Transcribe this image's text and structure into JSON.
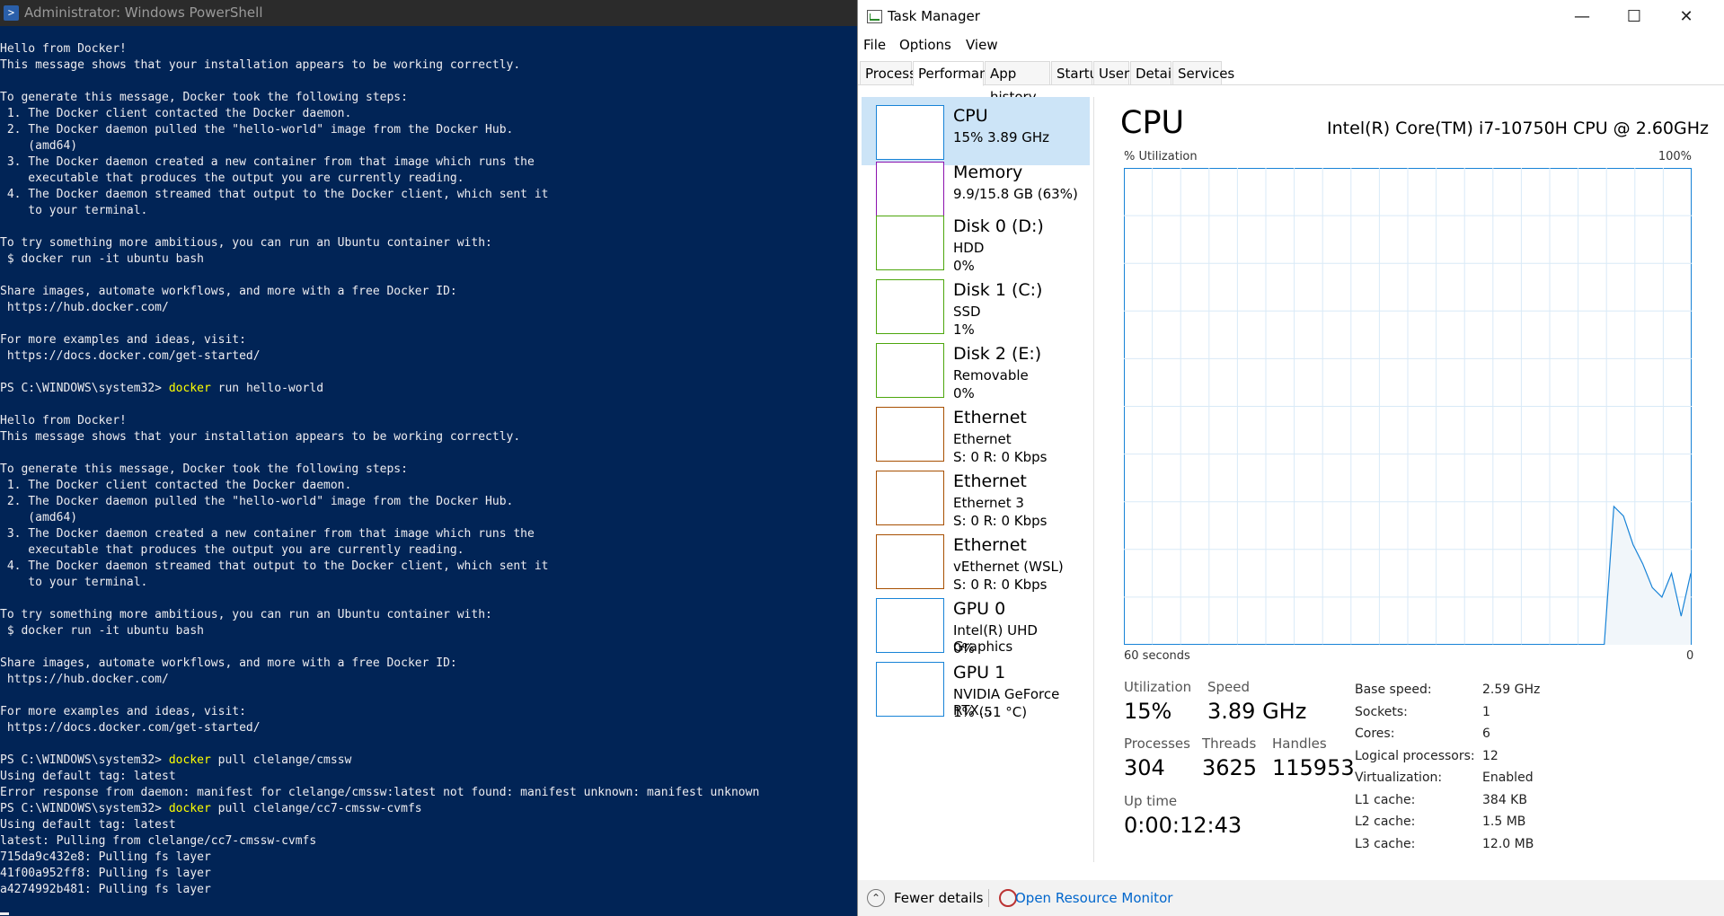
{
  "powershell": {
    "title": "Administrator: Windows PowerShell",
    "console": [
      {
        "text": "Hello from Docker!"
      },
      {
        "text": "This message shows that your installation appears to be working correctly."
      },
      {
        "text": ""
      },
      {
        "text": "To generate this message, Docker took the following steps:"
      },
      {
        "text": " 1. The Docker client contacted the Docker daemon."
      },
      {
        "text": " 2. The Docker daemon pulled the \"hello-world\" image from the Docker Hub."
      },
      {
        "text": "    (amd64)"
      },
      {
        "text": " 3. The Docker daemon created a new container from that image which runs the"
      },
      {
        "text": "    executable that produces the output you are currently reading."
      },
      {
        "text": " 4. The Docker daemon streamed that output to the Docker client, which sent it"
      },
      {
        "text": "    to your terminal."
      },
      {
        "text": ""
      },
      {
        "text": "To try something more ambitious, you can run an Ubuntu container with:"
      },
      {
        "text": " $ docker run -it ubuntu bash"
      },
      {
        "text": ""
      },
      {
        "text": "Share images, automate workflows, and more with a free Docker ID:"
      },
      {
        "text": " https://hub.docker.com/"
      },
      {
        "text": ""
      },
      {
        "text": "For more examples and ideas, visit:"
      },
      {
        "text": " https://docs.docker.com/get-started/"
      },
      {
        "text": ""
      },
      {
        "prompt": "PS C:\\WINDOWS\\system32> ",
        "cmd": "docker",
        "args": " run hello-world"
      },
      {
        "text": ""
      },
      {
        "text": "Hello from Docker!"
      },
      {
        "text": "This message shows that your installation appears to be working correctly."
      },
      {
        "text": ""
      },
      {
        "text": "To generate this message, Docker took the following steps:"
      },
      {
        "text": " 1. The Docker client contacted the Docker daemon."
      },
      {
        "text": " 2. The Docker daemon pulled the \"hello-world\" image from the Docker Hub."
      },
      {
        "text": "    (amd64)"
      },
      {
        "text": " 3. The Docker daemon created a new container from that image which runs the"
      },
      {
        "text": "    executable that produces the output you are currently reading."
      },
      {
        "text": " 4. The Docker daemon streamed that output to the Docker client, which sent it"
      },
      {
        "text": "    to your terminal."
      },
      {
        "text": ""
      },
      {
        "text": "To try something more ambitious, you can run an Ubuntu container with:"
      },
      {
        "text": " $ docker run -it ubuntu bash"
      },
      {
        "text": ""
      },
      {
        "text": "Share images, automate workflows, and more with a free Docker ID:"
      },
      {
        "text": " https://hub.docker.com/"
      },
      {
        "text": ""
      },
      {
        "text": "For more examples and ideas, visit:"
      },
      {
        "text": " https://docs.docker.com/get-started/"
      },
      {
        "text": ""
      },
      {
        "prompt": "PS C:\\WINDOWS\\system32> ",
        "cmd": "docker",
        "args": " pull clelange/cmssw"
      },
      {
        "text": "Using default tag: latest"
      },
      {
        "text": "Error response from daemon: manifest for clelange/cmssw:latest not found: manifest unknown: manifest unknown"
      },
      {
        "prompt": "PS C:\\WINDOWS\\system32> ",
        "cmd": "docker",
        "args": " pull clelange/cc7-cmssw-cvmfs"
      },
      {
        "text": "Using default tag: latest"
      },
      {
        "text": "latest: Pulling from clelange/cc7-cmssw-cvmfs"
      },
      {
        "text": "715da9c432e8: Pulling fs layer"
      },
      {
        "text": "41f00a952ff8: Pulling fs layer"
      },
      {
        "text": "a4274992b481: Pulling fs layer"
      }
    ]
  },
  "task_manager": {
    "title": "Task Manager",
    "menu": [
      "File",
      "Options",
      "View"
    ],
    "tabs": [
      "Processes",
      "Performance",
      "App history",
      "Startup",
      "Users",
      "Details",
      "Services"
    ],
    "active_tab": "Performance",
    "sidebar": [
      {
        "name": "CPU",
        "line2": "15%  3.89 GHz",
        "line3": "",
        "color": "#1883d7",
        "selected": true
      },
      {
        "name": "Memory",
        "line2": "9.9/15.8 GB (63%)",
        "line3": "",
        "color": "#8b12ae"
      },
      {
        "name": "Disk 0 (D:)",
        "line2": "HDD",
        "line3": "0%",
        "color": "#4da60c"
      },
      {
        "name": "Disk 1 (C:)",
        "line2": "SSD",
        "line3": "1%",
        "color": "#4da60c"
      },
      {
        "name": "Disk 2 (E:)",
        "line2": "Removable",
        "line3": "0%",
        "color": "#4da60c"
      },
      {
        "name": "Ethernet",
        "line2": "Ethernet",
        "line3": "S: 0  R: 0 Kbps",
        "color": "#a74f01"
      },
      {
        "name": "Ethernet",
        "line2": "Ethernet 3",
        "line3": "S: 0  R: 0 Kbps",
        "color": "#a74f01"
      },
      {
        "name": "Ethernet",
        "line2": "vEthernet (WSL)",
        "line3": "S: 0  R: 0 Kbps",
        "color": "#a74f01"
      },
      {
        "name": "GPU 0",
        "line2": "Intel(R) UHD Graphics",
        "line3": "0%",
        "color": "#1883d7"
      },
      {
        "name": "GPU 1",
        "line2": "NVIDIA GeForce RTX...",
        "line3": "1%  (51 °C)",
        "color": "#1883d7"
      }
    ],
    "cpu": {
      "title": "CPU",
      "model": "Intel(R) Core(TM) i7-10750H CPU @ 2.60GHz",
      "graph_label": "% Utilization",
      "graph_max": "100%",
      "x_left": "60 seconds",
      "x_right": "0",
      "graph_color": "#1883d7",
      "stats": {
        "utilization_label": "Utilization",
        "utilization": "15%",
        "speed_label": "Speed",
        "speed": "3.89 GHz",
        "processes_label": "Processes",
        "processes": "304",
        "threads_label": "Threads",
        "threads": "3625",
        "handles_label": "Handles",
        "handles": "115953",
        "uptime_label": "Up time",
        "uptime": "0:00:12:43"
      },
      "details": [
        {
          "label": "Base speed:",
          "value": "2.59 GHz"
        },
        {
          "label": "Sockets:",
          "value": "1"
        },
        {
          "label": "Cores:",
          "value": "6"
        },
        {
          "label": "Logical processors:",
          "value": "12"
        },
        {
          "label": "Virtualization:",
          "value": "Enabled"
        },
        {
          "label": "L1 cache:",
          "value": "384 KB"
        },
        {
          "label": "L2 cache:",
          "value": "1.5 MB"
        },
        {
          "label": "L3 cache:",
          "value": "12.0 MB"
        }
      ],
      "usage_history": [
        [
          0,
          0
        ],
        [
          1,
          0
        ],
        [
          2,
          0
        ],
        [
          3,
          0
        ],
        [
          4,
          0
        ],
        [
          5,
          0
        ],
        [
          6,
          0
        ],
        [
          7,
          0
        ],
        [
          8,
          0
        ],
        [
          9,
          0
        ],
        [
          10,
          0
        ],
        [
          11,
          0
        ],
        [
          12,
          0
        ],
        [
          13,
          0
        ],
        [
          14,
          0
        ],
        [
          15,
          0
        ],
        [
          16,
          0
        ],
        [
          17,
          0
        ],
        [
          18,
          0
        ],
        [
          19,
          0
        ],
        [
          20,
          0
        ],
        [
          21,
          0
        ],
        [
          22,
          0
        ],
        [
          23,
          0
        ],
        [
          24,
          0
        ],
        [
          25,
          0
        ],
        [
          26,
          0
        ],
        [
          27,
          0
        ],
        [
          28,
          0
        ],
        [
          29,
          0
        ],
        [
          30,
          0
        ],
        [
          31,
          0
        ],
        [
          32,
          0
        ],
        [
          33,
          0
        ],
        [
          34,
          0
        ],
        [
          35,
          0
        ],
        [
          36,
          0
        ],
        [
          37,
          0
        ],
        [
          38,
          0
        ],
        [
          39,
          0
        ],
        [
          40,
          0
        ],
        [
          41,
          0
        ],
        [
          42,
          0
        ],
        [
          43,
          0
        ],
        [
          44,
          0
        ],
        [
          45,
          0
        ],
        [
          46,
          0
        ],
        [
          47,
          0
        ],
        [
          48,
          0
        ],
        [
          49,
          0
        ],
        [
          50,
          0
        ],
        [
          51,
          29
        ],
        [
          52,
          27
        ],
        [
          53,
          21
        ],
        [
          54,
          17
        ],
        [
          55,
          12
        ],
        [
          56,
          10
        ],
        [
          57,
          15
        ],
        [
          58,
          6
        ],
        [
          59,
          15
        ]
      ]
    },
    "footer": {
      "fewer_details": "Fewer details",
      "open_monitor": "Open Resource Monitor"
    }
  }
}
